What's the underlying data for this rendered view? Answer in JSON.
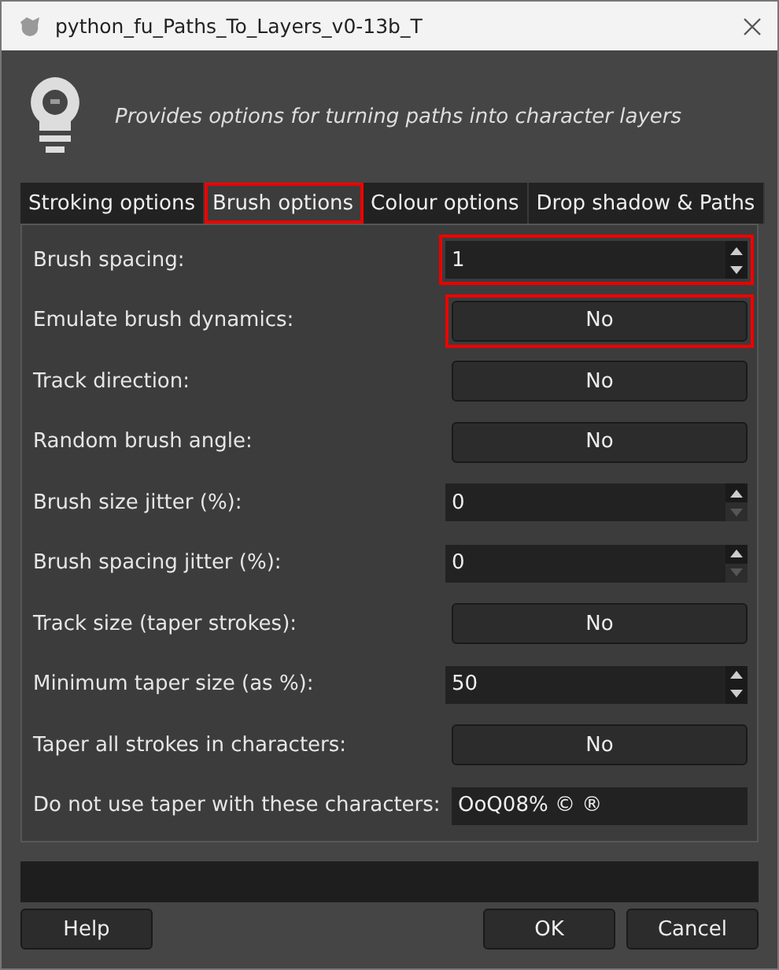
{
  "window": {
    "title": "python_fu_Paths_To_Layers_v0-13b_T"
  },
  "description": "Provides options for turning paths into character layers",
  "tabs": [
    {
      "label": "Stroking options",
      "selected": false,
      "highlighted": false
    },
    {
      "label": "Brush options",
      "selected": true,
      "highlighted": true
    },
    {
      "label": "Colour options",
      "selected": false,
      "highlighted": false
    },
    {
      "label": "Drop shadow & Paths",
      "selected": false,
      "highlighted": false
    }
  ],
  "rows": [
    {
      "label": "Brush spacing:",
      "kind": "spin",
      "value": "1",
      "down_disabled": false,
      "highlighted": true
    },
    {
      "label": "Emulate brush dynamics:",
      "kind": "toggle",
      "value": "No",
      "highlighted": true
    },
    {
      "label": "Track direction:",
      "kind": "toggle",
      "value": "No",
      "highlighted": false
    },
    {
      "label": "Random brush angle:",
      "kind": "toggle",
      "value": "No",
      "highlighted": false
    },
    {
      "label": "Brush size jitter (%):",
      "kind": "spin",
      "value": "0",
      "down_disabled": true,
      "highlighted": false
    },
    {
      "label": "Brush spacing jitter (%):",
      "kind": "spin",
      "value": "0",
      "down_disabled": true,
      "highlighted": false
    },
    {
      "label": "Track size (taper strokes):",
      "kind": "toggle",
      "value": "No",
      "highlighted": false
    },
    {
      "label": "Minimum taper size (as %):",
      "kind": "spin",
      "value": "50",
      "down_disabled": false,
      "highlighted": false
    },
    {
      "label": "Taper all strokes in characters:",
      "kind": "toggle",
      "value": "No",
      "highlighted": false
    },
    {
      "label": "Do not use taper with these characters:",
      "kind": "text",
      "value": "OoQ08% © ®",
      "highlighted": false
    }
  ],
  "progress": {
    "level": 0
  },
  "buttons": [
    {
      "label": "Help"
    },
    {
      "label": "OK"
    },
    {
      "label": "Cancel"
    }
  ]
}
